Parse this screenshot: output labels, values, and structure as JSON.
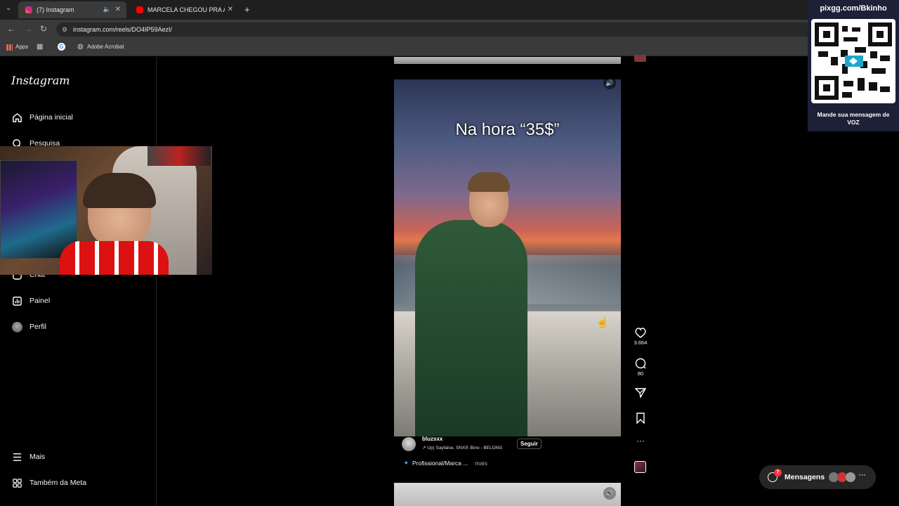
{
  "browser": {
    "tabs": [
      {
        "title": "(7) Instagram",
        "active": true
      },
      {
        "title": "MARCELA CHEGOU PRA AGILIZ",
        "active": false
      }
    ],
    "url": "instagram.com/reels/DO4IP59AezI/",
    "bookmarks": [
      "Apps",
      "Adobe Acrobat"
    ]
  },
  "sidebar": {
    "logo": "Instagram",
    "items": [
      {
        "label": "Página inicial",
        "icon": "home-icon"
      },
      {
        "label": "Pesquisa",
        "icon": "search-icon"
      },
      {
        "label": "Chat",
        "icon": "chat-icon"
      },
      {
        "label": "Painel",
        "icon": "dashboard-icon"
      },
      {
        "label": "Perfil",
        "icon": "profile-avatar"
      }
    ],
    "bottom": [
      {
        "label": "Mais",
        "icon": "menu-icon"
      },
      {
        "label": "Também da Meta",
        "icon": "meta-icon"
      }
    ]
  },
  "reel": {
    "caption_overlay": "Na hora “35$”",
    "username": "bluzsxx",
    "audio": "↗ Up)  Sayfalse, SNXP, Bino - BELONG",
    "follow_label": "Seguir",
    "description": "Profissional/Marca ...",
    "more_label": "mais",
    "likes": "3.664",
    "comments": "80"
  },
  "overlay": {
    "pix_url": "pixgg.com/Bkinho",
    "pix_message": "Mande sua mensagem de VOZ"
  },
  "messages": {
    "label": "Mensagens",
    "badge": "7"
  },
  "colors": {
    "ig_background": "#000000",
    "qr_panel": "#1d2036",
    "notification_red": "#ff3040"
  }
}
